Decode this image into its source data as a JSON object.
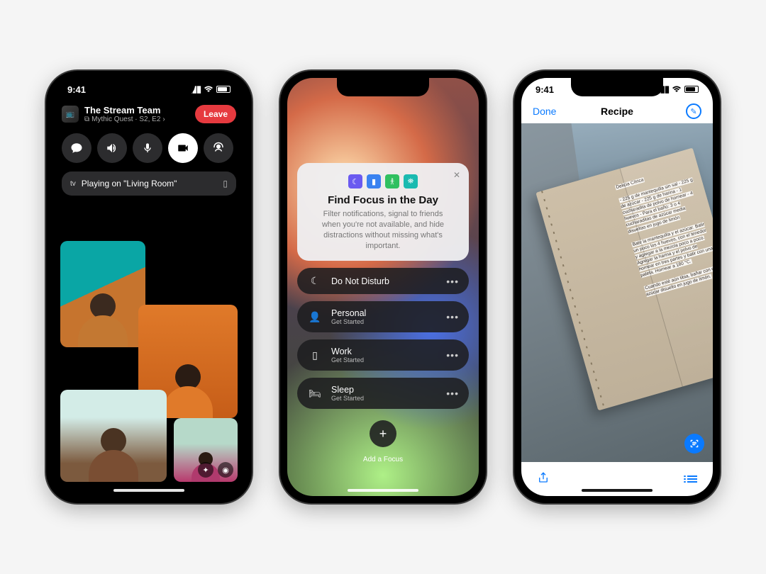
{
  "phone1": {
    "status_time": "9:41",
    "app_title": "The Stream Team",
    "app_subtitle": "Mythic Quest · S2, E2",
    "leave_label": "Leave",
    "airplay_text": "Playing on \"Living Room\"",
    "airplay_device_icon": "tv"
  },
  "phone2": {
    "card_title": "Find Focus in the Day",
    "card_desc": "Filter notifications, signal to friends when you're not available, and hide distractions without missing what's important.",
    "items": [
      {
        "icon": "moon",
        "title": "Do Not Disturb",
        "sub": ""
      },
      {
        "icon": "person",
        "title": "Personal",
        "sub": "Get Started"
      },
      {
        "icon": "briefcase",
        "title": "Work",
        "sub": "Get Started"
      },
      {
        "icon": "bed",
        "title": "Sleep",
        "sub": "Get Started"
      }
    ],
    "add_label": "Add a Focus"
  },
  "phone3": {
    "status_time": "9:41",
    "nav_done": "Done",
    "nav_title": "Recipe",
    "recipe_title": "Delicia Cítrica",
    "ingredients": "- 225 g de mantequilla sin sal\n- 225 g de azúcar\n- 225 g de harina\n- 1 cucharadita de polvo de hornear\n- 4 huevos\n- Para el baño: 3 o 4 cucharaditas de azúcar media disueltas en jugo de limón",
    "method": "Batir la mantequilla y el azúcar. Batir un poco los 4 huevos, con el tenedor y agregar a la mezcla poco a poco. Agregar la harina y el polvo de hornear en tres partes y batir con una paleta. Hornear a 180 °C.",
    "finish": "Cuando esté aún tibia, bañar con el azúcar disuelto en jugo de limón."
  }
}
